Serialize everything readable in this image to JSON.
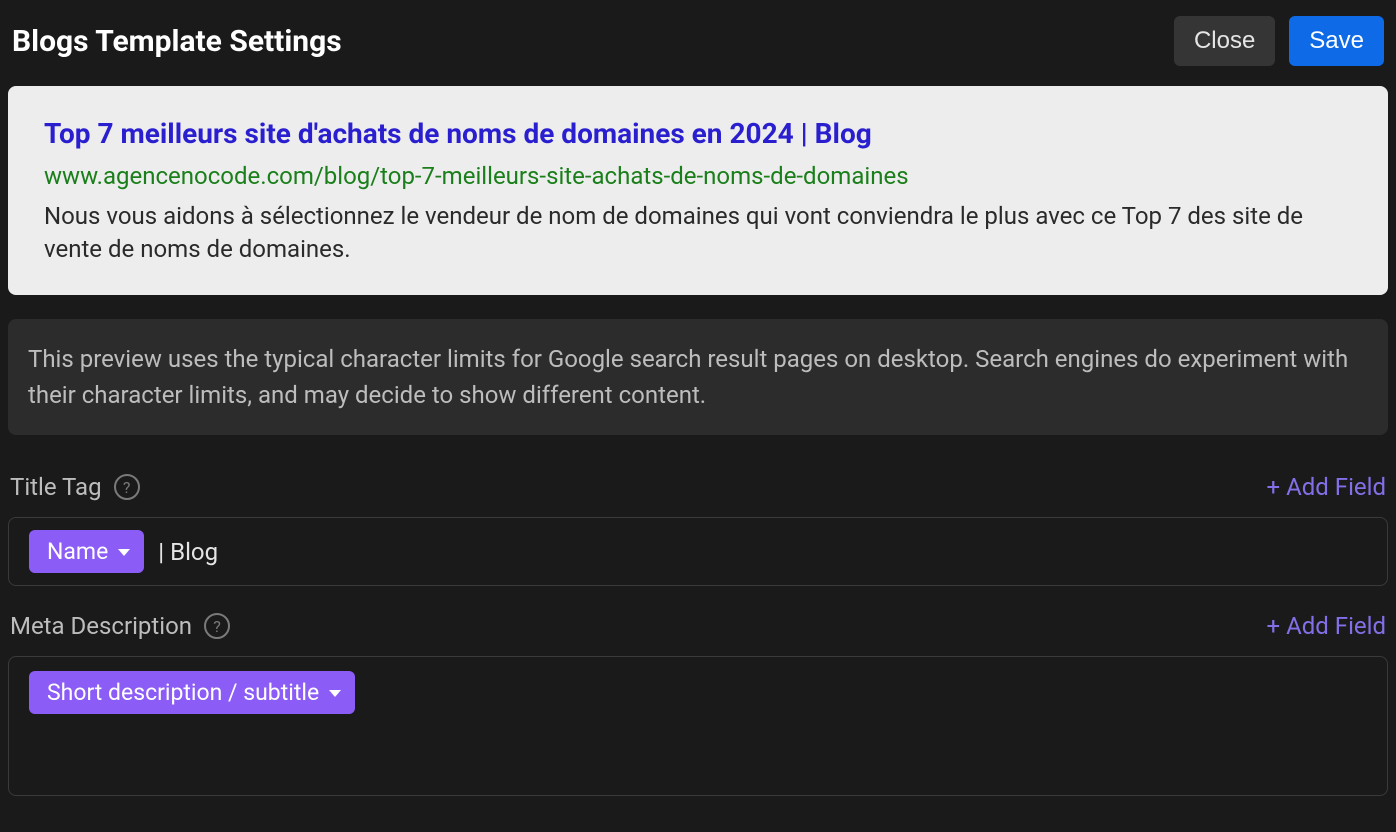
{
  "header": {
    "title": "Blogs Template Settings",
    "close_label": "Close",
    "save_label": "Save"
  },
  "preview": {
    "title": "Top 7 meilleurs site d'achats de noms de domaines en 2024 | Blog",
    "url": "www.agencenocode.com/blog/top-7-meilleurs-site-achats-de-noms-de-domaines",
    "description": "Nous vous aidons à sélectionnez le vendeur de nom de domaines qui vont conviendra le plus avec ce Top 7 des site de vente de noms de domaines."
  },
  "info": {
    "text": "This preview uses the typical character limits for Google search result pages on desktop. Search engines do experiment with their character limits, and may decide to show different content."
  },
  "title_tag": {
    "label": "Title Tag",
    "add_field_label": "+ Add Field",
    "chip_label": "Name",
    "suffix_text": "| Blog"
  },
  "meta_description": {
    "label": "Meta Description",
    "add_field_label": "+ Add Field",
    "chip_label": "Short description / subtitle"
  },
  "icons": {
    "help": "?"
  },
  "colors": {
    "background": "#1a1a1a",
    "accent_purple": "#8b5cf6",
    "accent_blue": "#0e6ae6",
    "link_purple": "#8170e8",
    "preview_title": "#2a1fcf",
    "preview_url": "#1a7f1a"
  }
}
